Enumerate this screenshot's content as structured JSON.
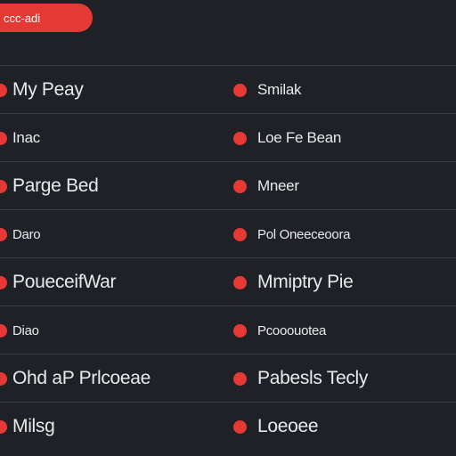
{
  "header": {
    "button_label": "ccc-adi"
  },
  "colors": {
    "accent": "#e53935",
    "background": "#1f2126",
    "divider": "#3a3d45",
    "text": "#e8e9ec"
  },
  "rows": [
    {
      "left": "My Peay",
      "right": "Smilak"
    },
    {
      "left": "Inac",
      "right": "Loe Fe Bean"
    },
    {
      "left": "Parge Bed",
      "right": "Mneer"
    },
    {
      "left": "Daro",
      "right": "Pol Oneeceoora"
    },
    {
      "left": "PoueceifWar",
      "right": "Mmiptry Pie"
    },
    {
      "left": "Diao",
      "right": "Pcooouotea"
    },
    {
      "left": "Ohd aP Prlcoeae",
      "right": "Pabesls Tecly"
    },
    {
      "left": "Milsg",
      "right": "Loeoee"
    }
  ]
}
